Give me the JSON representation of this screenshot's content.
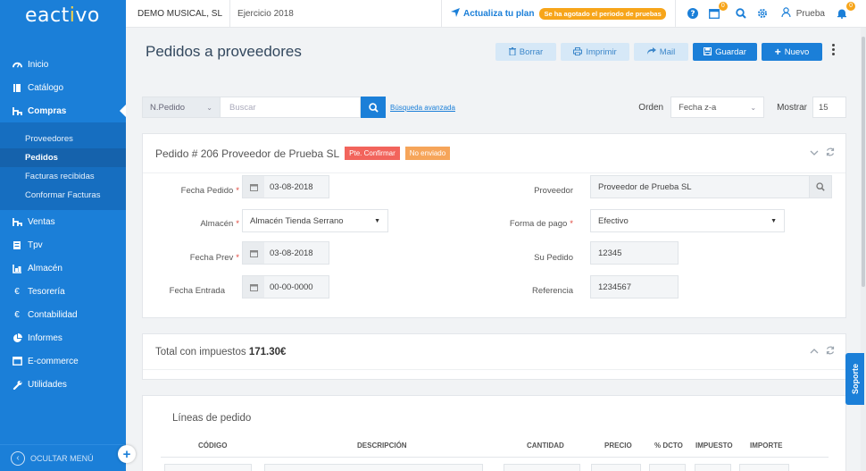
{
  "app": {
    "logo_text": "eactivo",
    "company": "DEMO MUSICAL, SL",
    "year": "Ejercicio 2018"
  },
  "topbar": {
    "plan_label": "Actualiza tu plan",
    "plan_badge": "Se ha agotado el periodo de pruebas",
    "calendar_count": "0",
    "bell_count": "0",
    "user": "Prueba",
    "icons": [
      "help-icon",
      "calendar-icon",
      "search-icon",
      "gear-icon",
      "user-icon",
      "bell-icon"
    ]
  },
  "sidebar": {
    "items": [
      {
        "label": "Inicio",
        "icon": "dashboard-icon"
      },
      {
        "label": "Catálogo",
        "icon": "book-icon"
      },
      {
        "label": "Compras",
        "icon": "cart-icon"
      },
      {
        "label": "Ventas",
        "icon": "sales-icon"
      },
      {
        "label": "Tpv",
        "icon": "pos-icon"
      },
      {
        "label": "Almacén",
        "icon": "warehouse-icon"
      },
      {
        "label": "Tesorería",
        "icon": "euro-icon"
      },
      {
        "label": "Contabilidad",
        "icon": "euro-icon"
      },
      {
        "label": "Informes",
        "icon": "pie-chart-icon"
      },
      {
        "label": "E-commerce",
        "icon": "browser-icon"
      },
      {
        "label": "Utilidades",
        "icon": "wrench-icon"
      }
    ],
    "sub_items": [
      "Proveedores",
      "Pedidos",
      "Facturas recibidas",
      "Conformar Facturas"
    ],
    "hide_menu": "OCULTAR MENÚ"
  },
  "header": {
    "title": "Pedidos a proveedores",
    "buttons": {
      "delete": "Borrar",
      "print": "Imprimir",
      "mail": "Mail",
      "save": "Guardar",
      "new": "Nuevo"
    }
  },
  "search": {
    "field_select": "N.Pedido",
    "placeholder": "Buscar",
    "advanced": "Búsqueda avanzada",
    "order_label": "Orden",
    "order_value": "Fecha z-a",
    "show_label": "Mostrar",
    "show_value": "15"
  },
  "order": {
    "title": "Pedido # 206 Proveedor de Prueba SL",
    "tag_status": "Pte. Confirmar",
    "tag_sent": "No enviado",
    "labels": {
      "fecha_pedido": "Fecha Pedido",
      "almacen": "Almacén",
      "fecha_prev": "Fecha Prev",
      "fecha_entrada": "Fecha Entrada",
      "proveedor": "Proveedor",
      "forma_pago": "Forma de pago",
      "su_pedido": "Su Pedido",
      "referencia": "Referencia"
    },
    "required_mark": "*",
    "values": {
      "fecha_pedido": "03-08-2018",
      "almacen": "Almacén Tienda Serrano",
      "fecha_prev": "03-08-2018",
      "fecha_entrada": "00-00-0000",
      "proveedor": "Proveedor de Prueba SL",
      "forma_pago": "Efectivo",
      "su_pedido": "12345",
      "referencia": "1234567"
    }
  },
  "totals": {
    "label": "Total con impuestos",
    "value": "171.30€"
  },
  "lines": {
    "title": "Líneas de pedido",
    "columns": [
      "CÓDIGO",
      "DESCRIPCIÓN",
      "CANTIDAD",
      "PRECIO",
      "% DCTO",
      "IMPUESTO",
      "IMPORTE"
    ]
  },
  "support": {
    "label": "Soporte"
  },
  "colors": {
    "primary": "#1b7fd8",
    "sidebar_sub": "#166ec0",
    "warning": "#f7a51a",
    "tag_red": "#f2645c",
    "tag_orange": "#f6a55a"
  }
}
